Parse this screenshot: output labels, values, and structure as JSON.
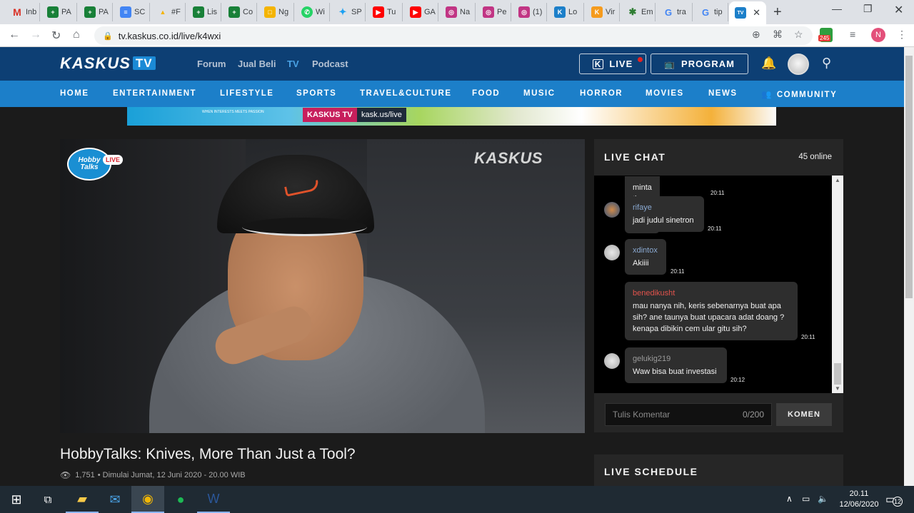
{
  "browser": {
    "tabs": [
      {
        "label": "Inb",
        "icon": "gmail-icon",
        "color": "#d93025",
        "glyph": "M"
      },
      {
        "label": "PA",
        "icon": "sheets-icon",
        "color": "#188038",
        "glyph": "+"
      },
      {
        "label": "PA",
        "icon": "sheets-icon",
        "color": "#188038",
        "glyph": "+"
      },
      {
        "label": "SC",
        "icon": "docs-icon",
        "color": "#4285f4",
        "glyph": "≡"
      },
      {
        "label": "#F",
        "icon": "drive-icon",
        "color": "#f4b400",
        "glyph": "▲"
      },
      {
        "label": "Lis",
        "icon": "sheets-icon",
        "color": "#188038",
        "glyph": "+"
      },
      {
        "label": "Co",
        "icon": "sheets-icon",
        "color": "#188038",
        "glyph": "+"
      },
      {
        "label": "Ng",
        "icon": "slides-icon",
        "color": "#f4b400",
        "glyph": "□"
      },
      {
        "label": "Wi",
        "icon": "whatsapp-icon",
        "color": "#25d366",
        "glyph": "✆"
      },
      {
        "label": "SP",
        "icon": "twitter-icon",
        "color": "#1da1f2",
        "glyph": "✦"
      },
      {
        "label": "Tu",
        "icon": "youtube-icon",
        "color": "#ff0000",
        "glyph": "▶"
      },
      {
        "label": "GA",
        "icon": "youtube-icon",
        "color": "#ff0000",
        "glyph": "▶"
      },
      {
        "label": "Na",
        "icon": "instagram-icon",
        "color": "#c13584",
        "glyph": "◎"
      },
      {
        "label": "Pe",
        "icon": "instagram-icon",
        "color": "#c13584",
        "glyph": "◎"
      },
      {
        "label": "(1)",
        "icon": "instagram-icon",
        "color": "#c13584",
        "glyph": "◎"
      },
      {
        "label": "Lo",
        "icon": "kaskus-icon",
        "color": "#1c7fc9",
        "glyph": "K"
      },
      {
        "label": "Vir",
        "icon": "kaskus-icon",
        "color": "#f59b1d",
        "glyph": "K"
      },
      {
        "label": "Em",
        "icon": "tree-icon",
        "color": "#2e7d32",
        "glyph": "✱"
      },
      {
        "label": "tra",
        "icon": "google-icon",
        "color": "#4285f4",
        "glyph": "G"
      },
      {
        "label": "tip",
        "icon": "google-icon",
        "color": "#4285f4",
        "glyph": "G"
      },
      {
        "label": "",
        "icon": "kaskus-tv-icon",
        "color": "#1c7fc9",
        "glyph": "TV"
      }
    ],
    "url": "tv.kaskus.co.id/live/k4wxi",
    "extension_badge": "245",
    "profile_initial": "N"
  },
  "site": {
    "logo": "KASKUS",
    "logo_tv": "TV",
    "topnav": [
      "Forum",
      "Jual Beli",
      "TV",
      "Podcast"
    ],
    "live_label": "LIVE",
    "program_label": "PROGRAM",
    "categories": [
      "HOME",
      "ENTERTAINMENT",
      "LIFESTYLE",
      "SPORTS",
      "TRAVEL&CULTURE",
      "FOOD",
      "MUSIC",
      "HORROR",
      "MOVIES",
      "NEWS",
      "COMMUNITY"
    ],
    "banner": {
      "tag": "KASKUS TV",
      "url": "kask.us/live",
      "small": "WHEN INTERESTS MEETS PASSION"
    }
  },
  "video": {
    "hobby_logo": "Hobby Talks",
    "live_badge": "LIVE",
    "watermark": "KASKUS",
    "title": "HobbyTalks: Knives, More Than Just a Tool?",
    "views": "1,751",
    "started": "• Dimulai Jumat, 12 Juni 2020 - 20.00 WIB"
  },
  "chat": {
    "title": "LIVE CHAT",
    "online": "45 online",
    "messages": [
      {
        "user": "",
        "text": "minta tips and tips",
        "time": "20:11"
      },
      {
        "user": "rifaye",
        "text": "jadi judul sinetron",
        "time": "20:11"
      },
      {
        "user": "xdintox",
        "text": "Akiiii",
        "time": "20:11"
      },
      {
        "user": "benedikusht",
        "text": "mau nanya nih, keris sebenarnya buat apa sih? ane taunya buat upacara adat doang ? kenapa dibikin cem ular gitu sih?",
        "time": "20:11"
      },
      {
        "user": "gelukig219",
        "text": "Waw bisa buat investasi",
        "time": "20:12"
      }
    ],
    "input_placeholder": "Tulis Komentar",
    "counter": "0/200",
    "submit": "KOMEN"
  },
  "schedule": {
    "title": "LIVE SCHEDULE"
  },
  "taskbar": {
    "time": "20.11",
    "date": "12/06/2020",
    "notifications": "12"
  }
}
